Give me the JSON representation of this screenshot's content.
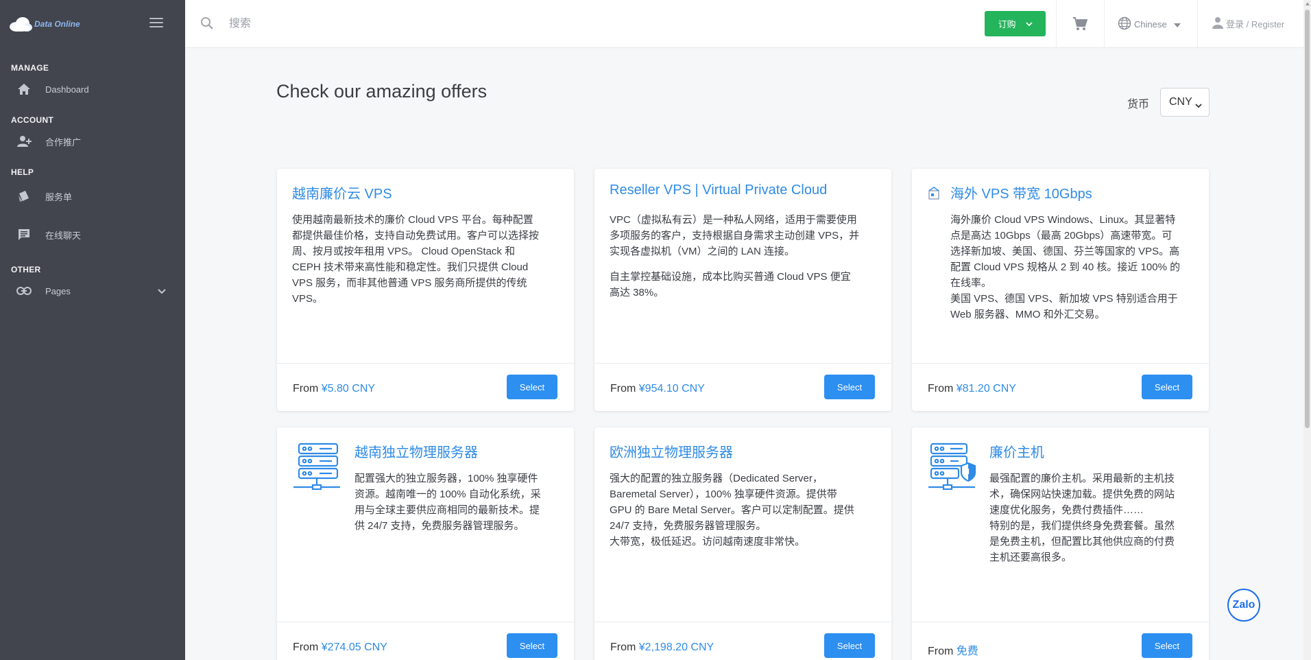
{
  "brand": {
    "name": "Data Online"
  },
  "sidebar": {
    "sections": [
      {
        "label": "MANAGE",
        "items": [
          {
            "label": "Dashboard",
            "icon": "home-icon"
          }
        ]
      },
      {
        "label": "ACCOUNT",
        "items": [
          {
            "label": "合作推广",
            "icon": "user-add-icon"
          }
        ]
      },
      {
        "label": "HELP",
        "items": [
          {
            "label": "服务单",
            "icon": "ticket-icon"
          },
          {
            "label": "在线聊天",
            "icon": "chat-icon"
          }
        ]
      },
      {
        "label": "OTHER",
        "items": [
          {
            "label": "Pages",
            "icon": "link-icon"
          }
        ]
      }
    ]
  },
  "topbar": {
    "search_placeholder": "搜索",
    "order_label": "订购",
    "language": "Chinese",
    "login_label": "登录 / Register"
  },
  "main": {
    "title": "Check our amazing offers",
    "currency_label": "货币",
    "currency_value": "CNY"
  },
  "cards": [
    {
      "title": "越南廉价云 VPS",
      "desc_lines": [
        "使用越南最新技术的廉价 Cloud VPS 平台。每种配置",
        "都提供最佳价格，支持自动免费试用。客户可以选择按",
        "周、按月或按年租用 VPS。 Cloud OpenStack 和",
        "CEPH 技术带来高性能和稳定性。我们只提供 Cloud",
        "VPS 服务，而非其他普通 VPS 服务商所提供的传统",
        "VPS。"
      ],
      "from_label": "From",
      "price": "¥5.80 CNY",
      "select_label": "Select"
    },
    {
      "title": "Reseller VPS | Virtual Private Cloud",
      "desc_para1": [
        "VPC（虚拟私有云）是一种私人网络，适用于需要使用",
        "多项服务的客户，支持根据自身需求主动创建 VPS，并",
        "实现各虚拟机（VM）之间的 LAN 连接。"
      ],
      "desc_para2": [
        "自主掌控基础设施，成本比购买普通 Cloud VPS 便宜",
        "高达 38%。"
      ],
      "from_label": "From",
      "price": "¥954.10 CNY",
      "select_label": "Select"
    },
    {
      "title": "海外 VPS 带宽 10Gbps",
      "desc_lines": [
        "海外廉价 Cloud VPS Windows、Linux。其显著特",
        "点是高达 10Gbps（最高 20Gbps）高速带宽。可",
        "选择新加坡、美国、德国、芬兰等国家的 VPS。高",
        "配置 Cloud VPS 规格从 2 到 40 核。接近 100% 的",
        "在线率。",
        "美国 VPS、德国 VPS、新加坡 VPS 特别适合用于",
        "Web 服务器、MMO 和外汇交易。"
      ],
      "from_label": "From",
      "price": "¥81.20 CNY",
      "select_label": "Select"
    },
    {
      "title": "越南独立物理服务器",
      "desc_lines": [
        "配置强大的独立服务器，100% 独享硬件",
        "资源。越南唯一的 100% 自动化系统，采",
        "用与全球主要供应商相同的最新技术。提",
        "供 24/7 支持，免费服务器管理服务。"
      ],
      "from_label": "From",
      "price": "¥274.05 CNY",
      "select_label": "Select"
    },
    {
      "title": "欧洲独立物理服务器",
      "desc_lines": [
        "强大的配置的独立服务器（Dedicated Server，",
        "Baremetal Server），100% 独享硬件资源。提供带",
        "GPU 的 Bare Metal Server。客户可以定制配置。提供",
        "24/7 支持，免费服务器管理服务。",
        "大带宽，极低延迟。访问越南速度非常快。"
      ],
      "from_label": "From",
      "price": "¥2,198.20 CNY",
      "select_label": "Select"
    },
    {
      "title": "廉价主机",
      "desc_lines": [
        "最强配置的廉价主机。采用最新的主机技",
        "术，确保网站快速加载。提供免费的网站",
        "速度优化服务，免费付费插件……",
        "特别的是，我们提供终身免费套餐。虽然",
        "是免费主机，但配置比其他供应商的付费",
        "主机还要高很多。"
      ],
      "from_label": "From",
      "price": "免费",
      "select_label": "Select"
    }
  ],
  "zalo": {
    "label": "Zalo"
  },
  "colors": {
    "sidebar_bg": "#42454d",
    "accent": "#2f8be6",
    "order_green": "#23b45c",
    "select_blue": "#2d8ff0"
  }
}
